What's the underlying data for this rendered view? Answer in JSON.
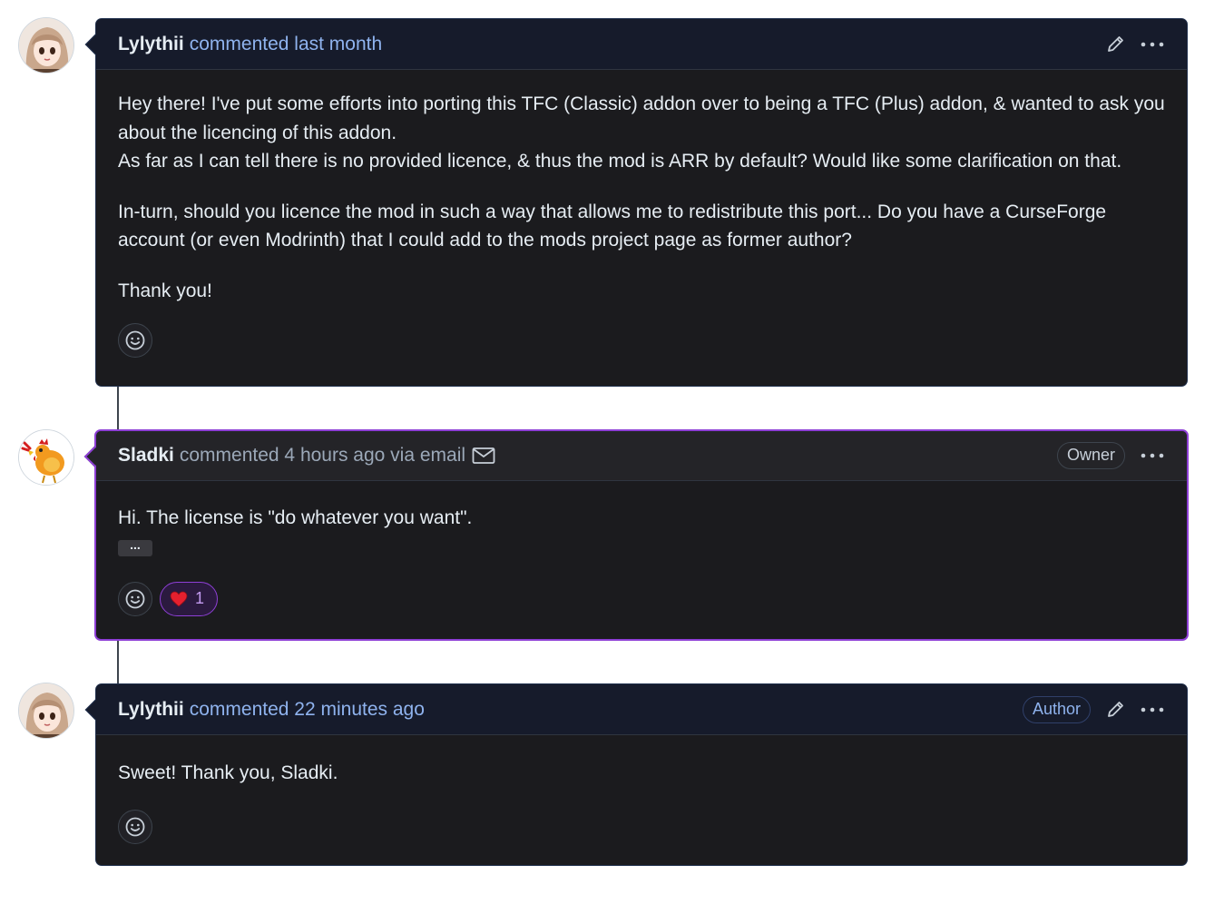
{
  "comments": [
    {
      "author": "Lylythii",
      "meta": "commented last month",
      "paragraphs": [
        "Hey there! I've put some efforts into porting this TFC (Classic) addon over to being a TFC (Plus) addon, & wanted to ask you about the licencing of this addon.",
        "As far as I can tell there is no provided licence, & thus the mod is ARR by default? Would like some clarification on that.",
        "In-turn, should you licence the mod in such a way that allows me to redistribute this port... Do you have a CurseForge account (or even Modrinth) that I could add to the mods project page as former author?",
        "Thank you!"
      ],
      "icons": [
        "pencil-icon",
        "kebab-icon",
        "smiley-icon"
      ]
    },
    {
      "author": "Sladki",
      "meta": "commented 4 hours ago via email",
      "badge": "Owner",
      "paragraphs": [
        "Hi. The license is \"do whatever you want\"."
      ],
      "hidden_text_toggle": "...",
      "reaction_count": "1",
      "icons": [
        "mail-icon",
        "kebab-icon",
        "smiley-icon",
        "heart-icon"
      ]
    },
    {
      "author": "Lylythii",
      "meta": "commented 22 minutes ago",
      "badge": "Author",
      "paragraphs": [
        "Sweet! Thank you, Sladki."
      ],
      "icons": [
        "pencil-icon",
        "kebab-icon",
        "smiley-icon"
      ]
    }
  ],
  "colors": {
    "highlight_border": "#8e3fd6",
    "blue_header": "#161b2b",
    "body_bg": "#1b1b1e",
    "meta_blue": "#8fb3ee"
  }
}
